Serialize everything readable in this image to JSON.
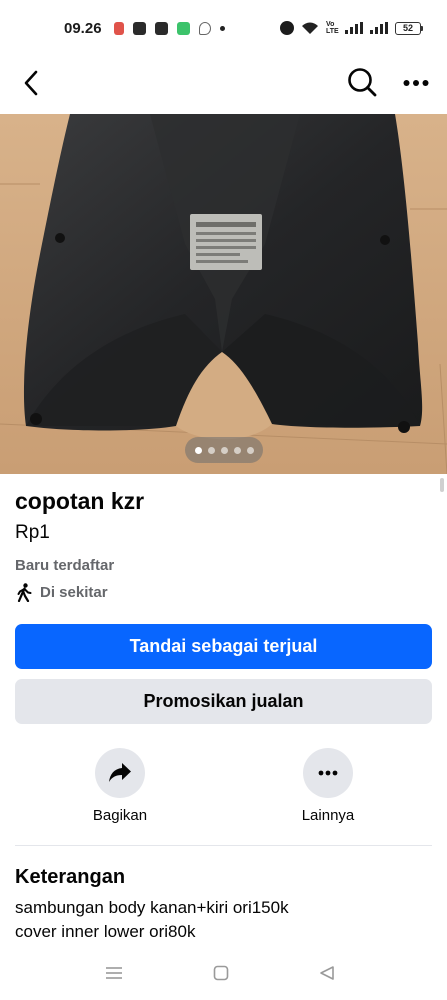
{
  "status_bar": {
    "time": "09.26",
    "battery": "52",
    "network_label": "Vo LTE"
  },
  "nav": {
    "back_icon": "chevron-left-icon",
    "search_icon": "search-icon",
    "more_icon": "more-horizontal-icon"
  },
  "gallery": {
    "photo_count": 5,
    "active_index": 0
  },
  "listing": {
    "title": "copotan kzr",
    "price": "Rp1",
    "listed": "Baru terdaftar",
    "location": "Di sekitar"
  },
  "buttons": {
    "mark_sold": "Tandai sebagai terjual",
    "promote": "Promosikan jualan"
  },
  "actions": {
    "share": {
      "label": "Bagikan",
      "icon": "share-arrow-icon"
    },
    "more": {
      "label": "Lainnya",
      "icon": "more-horizontal-icon"
    }
  },
  "description": {
    "heading": "Keterangan",
    "lines": [
      "sambungan body kanan+kiri ori150k",
      "cover inner lower ori80k"
    ]
  },
  "colors": {
    "primary_button": "#0866ff",
    "secondary_button": "#e4e6eb",
    "muted_text": "#65676b"
  }
}
